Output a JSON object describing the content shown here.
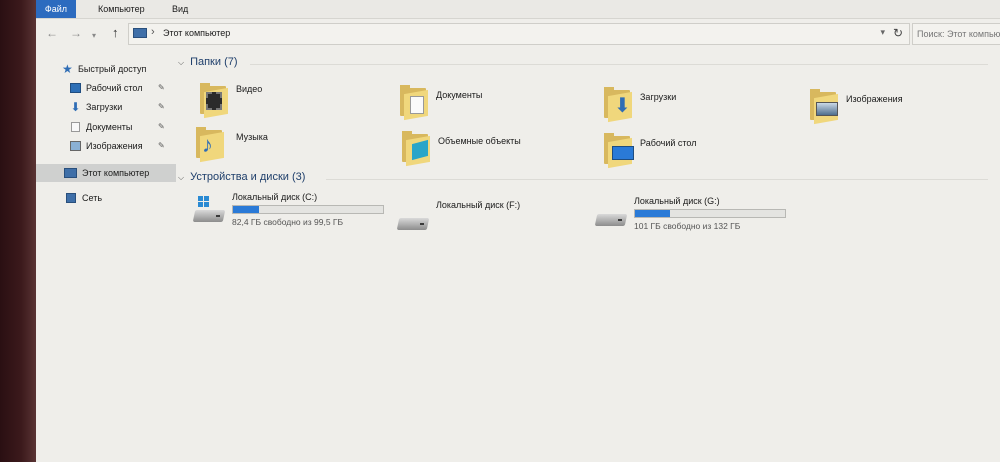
{
  "ribbon": {
    "tabs": [
      "Файл",
      "Компьютер",
      "Вид"
    ]
  },
  "address": {
    "path": "Этот компьютер",
    "search_placeholder": "Поиск: Этот компьютер"
  },
  "sidebar": {
    "quick_access": "Быстрый доступ",
    "items": [
      {
        "label": "Рабочий стол",
        "icon": "desktop-icon",
        "pinned": true
      },
      {
        "label": "Загрузки",
        "icon": "downloads-icon",
        "pinned": true
      },
      {
        "label": "Документы",
        "icon": "documents-icon",
        "pinned": true
      },
      {
        "label": "Изображения",
        "icon": "pictures-icon",
        "pinned": true
      }
    ],
    "this_pc": "Этот компьютер",
    "network": "Сеть"
  },
  "folders_group": {
    "title": "Папки (7)"
  },
  "folders": [
    {
      "name": "Видео",
      "icon": "videos-folder-icon"
    },
    {
      "name": "Документы",
      "icon": "documents-folder-icon"
    },
    {
      "name": "Загрузки",
      "icon": "downloads-folder-icon"
    },
    {
      "name": "Изображения",
      "icon": "pictures-folder-icon"
    },
    {
      "name": "Музыка",
      "icon": "music-folder-icon"
    },
    {
      "name": "Объемные объекты",
      "icon": "3d-objects-folder-icon"
    },
    {
      "name": "Рабочий стол",
      "icon": "desktop-folder-icon"
    }
  ],
  "drives_group": {
    "title": "Устройства и диски (3)"
  },
  "drives": [
    {
      "name": "Локальный диск (C:)",
      "free_text": "82,4 ГБ свободно из 99,5 ГБ",
      "used_fraction": 0.17,
      "system": true
    },
    {
      "name": "Локальный диск (F:)",
      "free_text": "",
      "used_fraction": null,
      "system": false
    },
    {
      "name": "Локальный диск (G:)",
      "free_text": "101 ГБ свободно из 132 ГБ",
      "used_fraction": 0.23,
      "system": false
    }
  ],
  "colors": {
    "accent": "#2c6bbf",
    "drive_bar": "#2a7ad7",
    "folder": "#e8c766"
  }
}
